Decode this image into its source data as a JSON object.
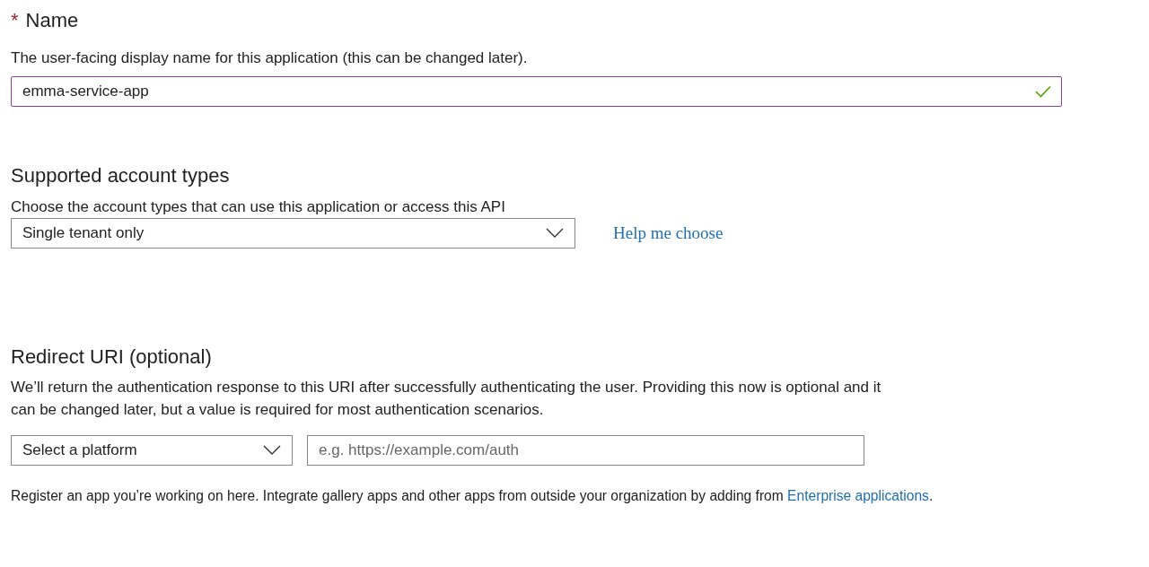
{
  "name_section": {
    "label": "Name",
    "required": true,
    "required_mark": "*",
    "description": "The user-facing display name for this application (this can be changed later).",
    "value": "emma-service-app",
    "valid": true
  },
  "account_types": {
    "heading": "Supported account types",
    "description": "Choose the account types that can use this application or access this API",
    "select_value": "Single tenant only",
    "help_link": "Help me choose"
  },
  "redirect_uri": {
    "heading": "Redirect URI (optional)",
    "description": "We’ll return the authentication response to this URI after successfully authenticating the user. Providing this now is optional and it can be changed later, but a value is required for most authentication scenarios.",
    "platform_select": "Select a platform",
    "uri_placeholder": "e.g. https://example.com/auth"
  },
  "footer": {
    "text": "Register an app you’re working on here. Integrate gallery apps and other apps from outside your organization by adding from",
    "link": "Enterprise applications",
    "end": "."
  }
}
